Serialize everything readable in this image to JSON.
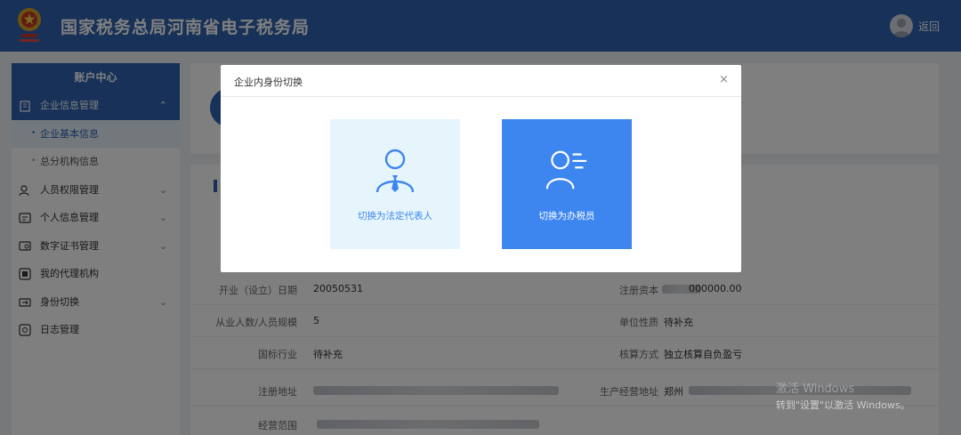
{
  "header": {
    "title": "国家税务总局河南省电子税务局",
    "back_label": "返回",
    "brand_color": "#2f63b2"
  },
  "sidebar": {
    "title": "账户中心",
    "items": [
      {
        "label": "企业信息管理",
        "icon": "building-icon",
        "chevron": "⌃"
      },
      {
        "label": "企业基本信息"
      },
      {
        "label": "总分机构信息"
      },
      {
        "label": "人员权限管理",
        "icon": "user-lock-icon",
        "chevron": "⌄"
      },
      {
        "label": "个人信息管理",
        "icon": "id-card-icon",
        "chevron": "⌄"
      },
      {
        "label": "数字证书管理",
        "icon": "certificate-icon",
        "chevron": "⌄"
      },
      {
        "label": "我的代理机构",
        "icon": "agency-icon"
      },
      {
        "label": "身份切换",
        "icon": "switch-icon",
        "chevron": "⌄"
      },
      {
        "label": "日志管理",
        "icon": "log-icon"
      }
    ]
  },
  "info": {
    "rows": [
      {
        "label": "开业（设立）日期",
        "value": "20050531",
        "label2": "注册资本",
        "value2": "000000.00"
      },
      {
        "label": "从业人数/人员规模",
        "value": "5",
        "label2": "单位性质",
        "value2": "待补充"
      },
      {
        "label": "国标行业",
        "value": "待补充",
        "label2": "核算方式",
        "value2": "独立核算自负盈亏"
      },
      {
        "label": "注册地址",
        "value": "",
        "label2": "生产经营地址",
        "value2": "郑州"
      },
      {
        "label": "经营范围",
        "value": ""
      }
    ]
  },
  "modal": {
    "title": "企业内身份切换",
    "close": "×",
    "options": [
      {
        "label": "切换为法定代表人",
        "icon": "legal-representative-icon"
      },
      {
        "label": "切换为办税员",
        "icon": "tax-clerk-icon"
      }
    ],
    "accent_color": "#3d86f0"
  },
  "watermark": {
    "line1": "激活 Windows",
    "line2": "转到\"设置\"以激活 Windows。"
  }
}
